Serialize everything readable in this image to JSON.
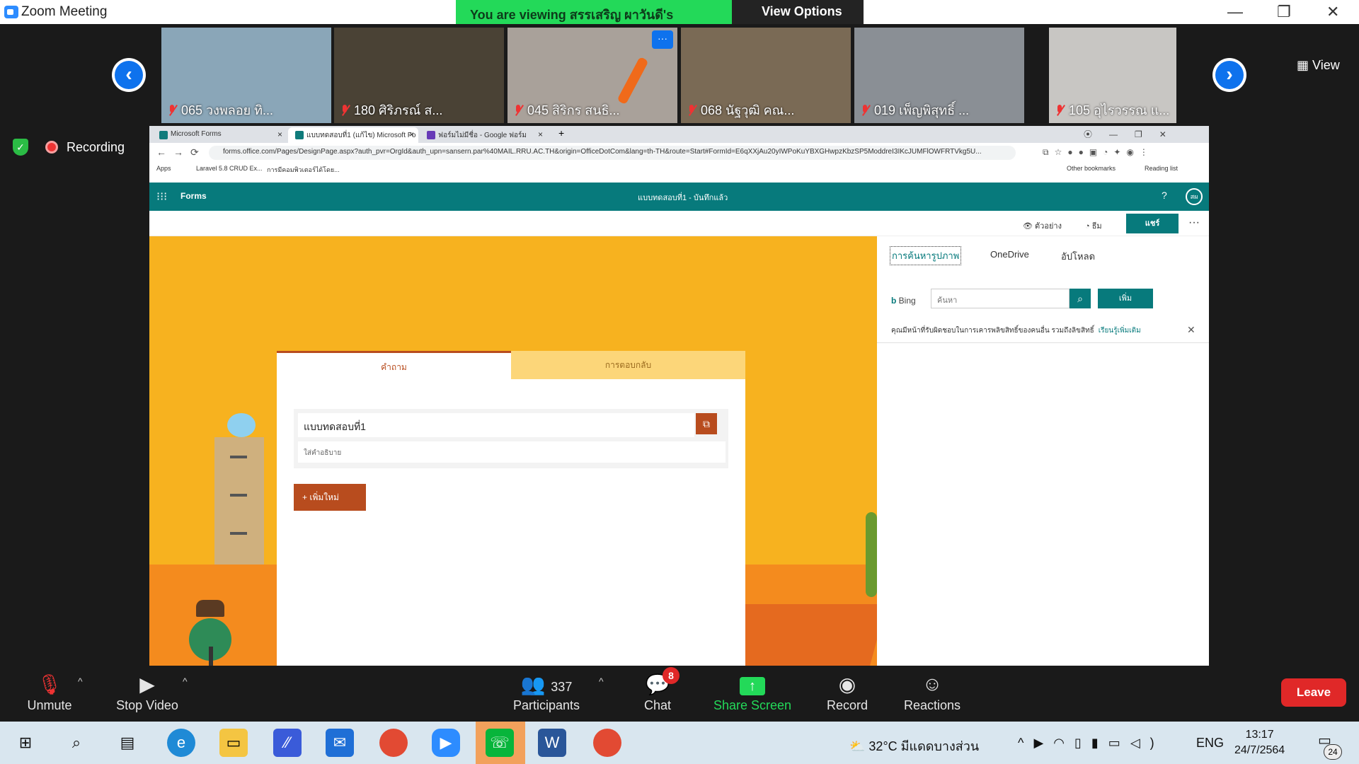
{
  "window": {
    "title": "Zoom Meeting"
  },
  "banner": {
    "viewing": "You are viewing สรรเสริญ ผาวันดี's screen",
    "view_options": "View Options ⌄"
  },
  "window_controls": {
    "minimize": "—",
    "restore": "❐",
    "close": "✕"
  },
  "participants_strip": {
    "prev_icon": "‹",
    "next_icon": "›",
    "view_label": "View",
    "tiles": [
      {
        "name": "065 วงพลอย ทิ...",
        "bg": "#8aa6b8"
      },
      {
        "name": "180 ศิริภรณ์  ส...",
        "bg": "#4a4235"
      },
      {
        "name": "045  สิริกร สนธิ...",
        "bg": "#a9a19a"
      },
      {
        "name": "068 นัฐวุฒิ คณ...",
        "bg": "#7a6a55"
      },
      {
        "name": "019 เพ็ญพิสุทธิ์ ...",
        "bg": "#8a8f95"
      },
      {
        "name": "105 อุไรวรรณ แ...",
        "bg": "#c8c6c3"
      }
    ],
    "more_icon": "···"
  },
  "recording": {
    "label": "Recording"
  },
  "browser": {
    "tabs": [
      {
        "label": "Microsoft Forms"
      },
      {
        "label": "แบบทดสอบที่1 (แก้ไข) Microsoft Fo"
      },
      {
        "label": "ฟอร์มไม่มีชื่อ - Google ฟอร์ม"
      }
    ],
    "new_tab": "+",
    "url": "forms.office.com/Pages/DesignPage.aspx?auth_pvr=OrgId&auth_upn=sansern.par%40MAIL.RRU.AC.TH&origin=OfficeDotCom&lang=th-TH&route=Start#FormId=E6qXXjAu20yIWPoKuYBXGHwpzKbzSP5ModdreI3IKcJUMFlOWFRTVkg5U...",
    "bookmarks": {
      "apps": "Apps",
      "b1": "Laravel 5.8 CRUD Ex...",
      "b2": "การมีคอมพิวเตอร์ได้โดย...",
      "other": "Other bookmarks",
      "reading": "Reading list"
    }
  },
  "forms": {
    "app_name": "Forms",
    "doc_title": "แบบทดสอบที่1 - บันทึกแล้ว",
    "help": "?",
    "avatar": "สผ",
    "preview": "ตัวอย่าง",
    "theme": "ธีม",
    "share": "แชร์",
    "more": "···",
    "tab_questions": "คำถาม",
    "tab_responses": "การตอบกลับ",
    "form_title": "แบบทดสอบที่1",
    "form_desc": "ใส่คำอธิบาย",
    "add_new": "+   เพิ่มใหม่"
  },
  "image_pane": {
    "tab_search": "การค้นหารูปภาพ",
    "tab_onedrive": "OneDrive",
    "tab_upload": "อัปโหลด",
    "bing": "Bing",
    "search_placeholder": "ค้นหา",
    "add_button": "เพิ่ม",
    "note": "คุณมีหน้าที่รับผิดชอบในการเคารพลิขสิทธิ์ของคนอื่น รวมถึงลิขสิทธิ์",
    "learn_more": "เรียนรู้เพิ่มเติม",
    "close": "✕"
  },
  "toolbar": {
    "unmute": "Unmute",
    "stop_video": "Stop Video",
    "participants": "Participants",
    "participants_count": "337",
    "chat": "Chat",
    "chat_badge": "8",
    "share_screen": "Share Screen",
    "record": "Record",
    "reactions": "Reactions",
    "leave": "Leave",
    "caret": "^"
  },
  "taskbar": {
    "weather": "32°C  มีแดดบางส่วน",
    "lang": "ENG",
    "time": "13:17",
    "date": "24/7/2564",
    "notifications": "24"
  }
}
